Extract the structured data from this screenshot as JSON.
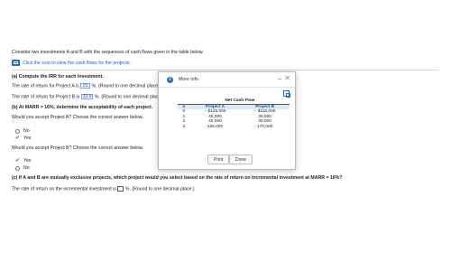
{
  "intro": "Consider two investments A and B with the sequences of cash flows given in the table below.",
  "cash_flow_link": "Click the icon to view the cash flows for the projects.",
  "part_a": {
    "heading": "(a) Compute the IRR for each investment.",
    "line_a_prefix": "The rate of return for Project A is",
    "line_a_value": "31",
    "line_a_suffix": "%. (Round to one decimal place.)",
    "line_b_prefix": "The rate of return for Project B is",
    "line_b_value": "33.9",
    "line_b_suffix": "%. (Round to one decimal place.)"
  },
  "part_b": {
    "heading": "(b) At MARR = 16%, determine the acceptability of each project.",
    "q_a": "Would you accept Project A? Choose the correct answer below.",
    "q_a_options": [
      {
        "label": "No",
        "selected": false
      },
      {
        "label": "Yes",
        "selected": true
      }
    ],
    "q_b": "Would you accept Project B? Choose the correct answer below.",
    "q_b_options": [
      {
        "label": "Yes",
        "selected": true
      },
      {
        "label": "No",
        "selected": false
      }
    ]
  },
  "part_c": {
    "heading": "(c) If A and B are mutually exclusive projects, which project would you select based on the rate of return on incremental investment at MARR = 16%?",
    "line_prefix": "The rate of return on the incremental investment is",
    "line_value": "",
    "line_suffix": "%. (Round to one decimal place.)"
  },
  "modal": {
    "title": "More Info",
    "minimize": "–",
    "close": "✕",
    "table": {
      "group_header": "Net Cash Flow",
      "col_n": "n",
      "col_a": "Project A",
      "col_b": "Project B",
      "rows": [
        {
          "n": "0",
          "a": "– $125,000",
          "b": "– $110,000"
        },
        {
          "n": "1",
          "a": "40,000",
          "b": "30,000"
        },
        {
          "n": "2",
          "a": "40,000",
          "b": "30,000"
        },
        {
          "n": "3",
          "a": "165,000",
          "b": "170,000"
        }
      ]
    },
    "print_label": "Print",
    "done_label": "Done"
  },
  "icons": {
    "cash_flow": "table-icon",
    "info": "info-icon",
    "copy": "copy-icon"
  },
  "colors": {
    "accent": "#2a6ebb",
    "answer_bg": "#eef5fd",
    "check": "#2e8b2e"
  }
}
